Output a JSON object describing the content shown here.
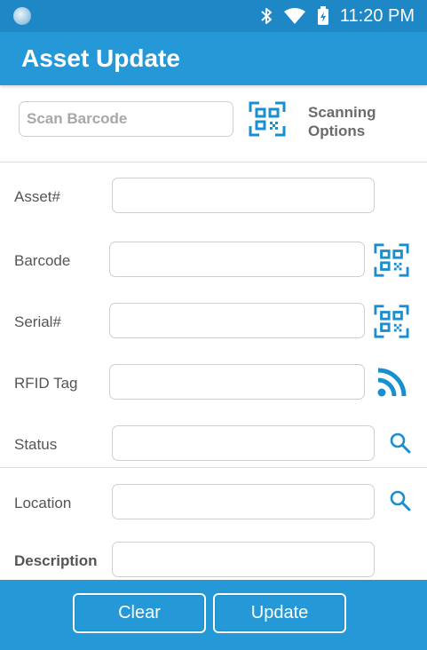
{
  "status_bar": {
    "time": "11:20 PM",
    "icons": [
      "app-notification-icon",
      "bluetooth-icon",
      "wifi-icon",
      "battery-icon"
    ]
  },
  "app_bar": {
    "title": "Asset Update"
  },
  "scan": {
    "placeholder": "Scan Barcode",
    "value": "",
    "options_label": "Scanning Options",
    "options_icon": "qr-scan-icon"
  },
  "fields": {
    "asset": {
      "label": "Asset#",
      "value": ""
    },
    "barcode": {
      "label": "Barcode",
      "value": "",
      "icon": "qr-scan-icon"
    },
    "serial": {
      "label": "Serial#",
      "value": "",
      "icon": "qr-scan-icon"
    },
    "rfid": {
      "label": "RFID Tag",
      "value": "",
      "icon": "rfid-icon"
    },
    "status": {
      "label": "Status",
      "value": "",
      "icon": "search-icon"
    },
    "location": {
      "label": "Location",
      "value": "",
      "icon": "search-icon"
    },
    "description": {
      "label": "Description",
      "value": ""
    }
  },
  "actions": {
    "clear_label": "Clear",
    "update_label": "Update"
  },
  "colors": {
    "primary": "#2599d8",
    "status_bar": "#1e88c7",
    "icon_accent": "#1a8fd0"
  }
}
